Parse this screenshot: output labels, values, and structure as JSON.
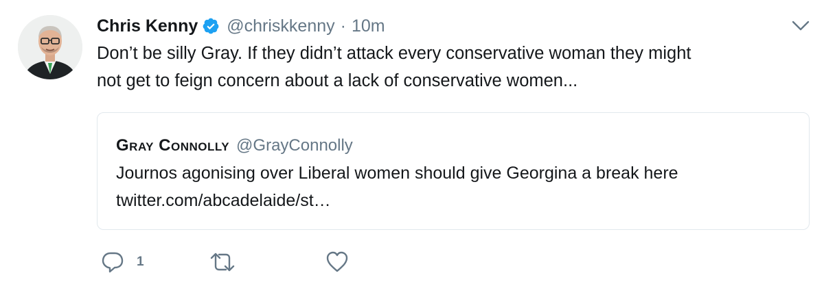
{
  "tweet": {
    "author_name": "Chris Kenny",
    "handle": "@chriskkenny",
    "separator": "·",
    "time": "10m",
    "text": "Don’t be silly Gray. If they didn’t  attack every conservative woman they might\nnot get to feign concern about a lack of conservative women...",
    "verified_icon": "verified-badge-icon",
    "menu_icon": "chevron-down-icon"
  },
  "quote": {
    "author_name": "Gray Connolly",
    "handle": "@GrayConnolly",
    "text_line1": "Journos agonising over Liberal women should give Georgina a break here",
    "text_line2": "twitter.com/abcadelaide/st…"
  },
  "actions": {
    "reply_count": "1",
    "reply_icon": "reply-icon",
    "retweet_icon": "retweet-icon",
    "like_icon": "heart-icon"
  },
  "colors": {
    "text": "#14171a",
    "muted": "#657786",
    "verified": "#1da1f2",
    "border": "#e1e8ed"
  }
}
